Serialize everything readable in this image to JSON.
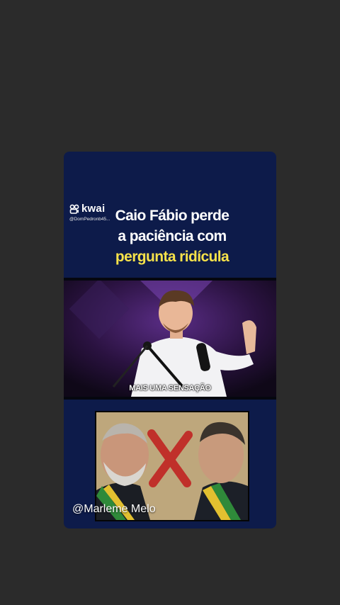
{
  "kwai": {
    "brand": "kwai",
    "handle": "@DomPedronb45..."
  },
  "headline": {
    "line1": "Caio Fábio perde",
    "line2": "a paciência com",
    "line3": "pergunta ridícula"
  },
  "video": {
    "caption": "MAIS UMA SENSAÇÃO"
  },
  "watermark": "@Marleme Melo",
  "colors": {
    "background": "#2b2b2b",
    "card": "#0d1b4a",
    "headline_accent": "#f6e24a"
  }
}
